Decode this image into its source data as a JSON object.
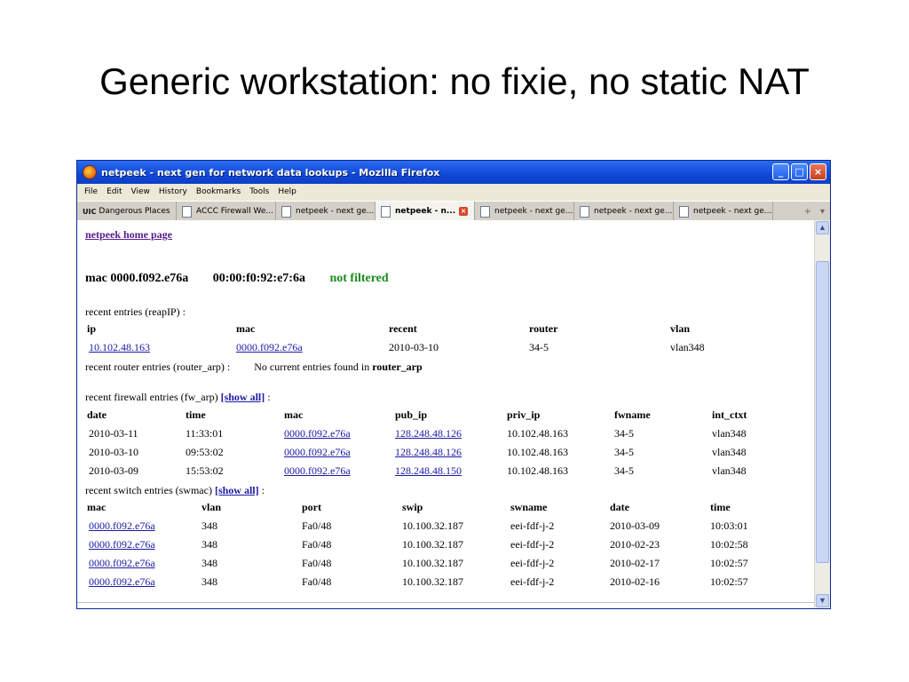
{
  "slide": {
    "title": "Generic workstation: no fixie, no static NAT"
  },
  "window": {
    "title": "netpeek - next gen for network data lookups - Mozilla Firefox",
    "controls": {
      "minimize": "_",
      "maximize": "□",
      "close": "×"
    }
  },
  "menu": [
    "File",
    "Edit",
    "View",
    "History",
    "Bookmarks",
    "Tools",
    "Help"
  ],
  "tabs": [
    {
      "label": "Dangerous Places",
      "badge": "UIC"
    },
    {
      "label": "ACCC Firewall We..."
    },
    {
      "label": "netpeek - next ge..."
    },
    {
      "label": "netpeek - n...",
      "active": true
    },
    {
      "label": "netpeek - next ge..."
    },
    {
      "label": "netpeek - next ge..."
    },
    {
      "label": "netpeek - next ge..."
    }
  ],
  "tab_tools": {
    "new_tab": "+",
    "list": "▾"
  },
  "page": {
    "home_link": "netpeek home page",
    "mac_dotted": "mac 0000.f092.e76a",
    "mac_colon": "00:00:f0:92:e7:6a",
    "filter_status": "not filtered",
    "reapip": {
      "title": "recent entries (reapIP) :",
      "headers": [
        "ip",
        "mac",
        "recent",
        "router",
        "vlan"
      ],
      "rows": [
        [
          "10.102.48.163",
          "0000.f092.e76a",
          "2010-03-10",
          "34-5",
          "vlan348"
        ]
      ]
    },
    "router_arp": {
      "title": "recent router entries (router_arp) :",
      "message_prefix": "No current entries found in ",
      "message_table": "router_arp"
    },
    "fw_arp": {
      "title": "recent firewall entries (fw_arp)",
      "show_all": "[show all]",
      "colon": ":",
      "headers": [
        "date",
        "time",
        "mac",
        "pub_ip",
        "priv_ip",
        "fwname",
        "int_ctxt"
      ],
      "rows": [
        [
          "2010-03-11",
          "11:33:01",
          "0000.f092.e76a",
          "128.248.48.126",
          "10.102.48.163",
          "34-5",
          "vlan348"
        ],
        [
          "2010-03-10",
          "09:53:02",
          "0000.f092.e76a",
          "128.248.48.126",
          "10.102.48.163",
          "34-5",
          "vlan348"
        ],
        [
          "2010-03-09",
          "15:53:02",
          "0000.f092.e76a",
          "128.248.48.150",
          "10.102.48.163",
          "34-5",
          "vlan348"
        ]
      ]
    },
    "swmac": {
      "title": "recent switch entries (swmac)",
      "show_all": "[show all]",
      "colon": ":",
      "headers": [
        "mac",
        "vlan",
        "port",
        "swip",
        "swname",
        "date",
        "time"
      ],
      "rows": [
        [
          "0000.f092.e76a",
          "348",
          "Fa0/48",
          "10.100.32.187",
          "eei-fdf-j-2",
          "2010-03-09",
          "10:03:01"
        ],
        [
          "0000.f092.e76a",
          "348",
          "Fa0/48",
          "10.100.32.187",
          "eei-fdf-j-2",
          "2010-02-23",
          "10:02:58"
        ],
        [
          "0000.f092.e76a",
          "348",
          "Fa0/48",
          "10.100.32.187",
          "eei-fdf-j-2",
          "2010-02-17",
          "10:02:57"
        ],
        [
          "0000.f092.e76a",
          "348",
          "Fa0/48",
          "10.100.32.187",
          "eei-fdf-j-2",
          "2010-02-16",
          "10:02:57"
        ]
      ]
    }
  },
  "scrollbar": {
    "up": "▲",
    "down": "▼"
  }
}
